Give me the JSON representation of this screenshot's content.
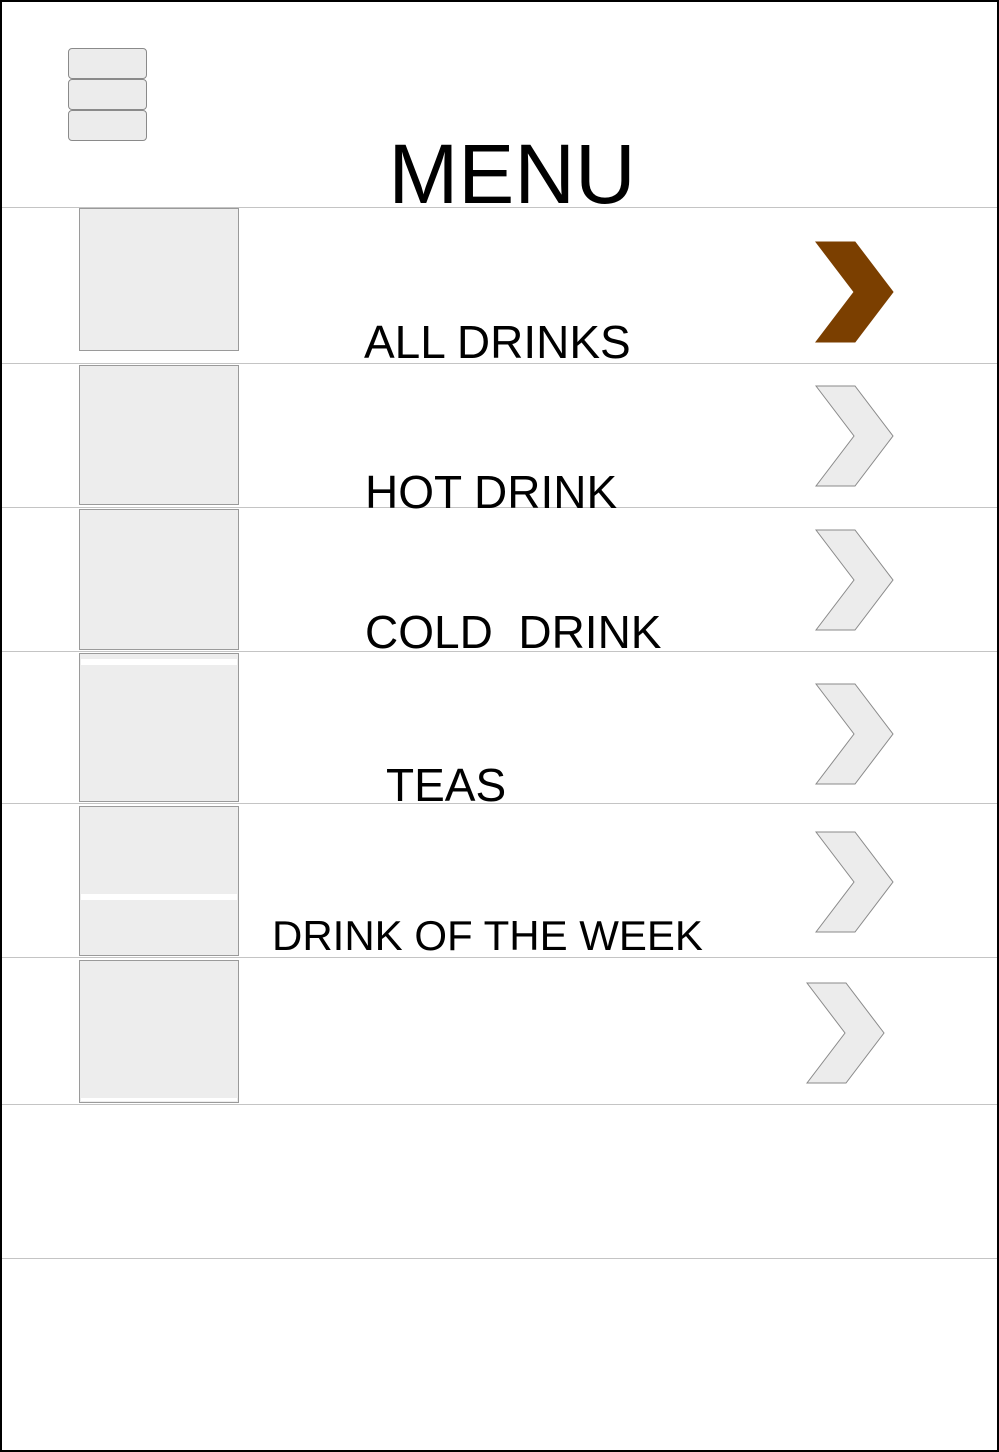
{
  "header": {
    "title": "MENU",
    "menu_icon": "hamburger-menu-icon"
  },
  "colors": {
    "accent": "#7b3f00",
    "chevron_inactive": "#ececec",
    "divider": "#c4c4c4",
    "thumb_fill": "#ededed"
  },
  "menu": {
    "items": [
      {
        "label": "ALL DRINKS",
        "icon": "chevron-right-icon",
        "selected": true
      },
      {
        "label": "HOT DRINK",
        "icon": "chevron-right-icon",
        "selected": false
      },
      {
        "label": "COLD  DRINK",
        "icon": "chevron-right-icon",
        "selected": false
      },
      {
        "label": "TEAS",
        "icon": "chevron-right-icon",
        "selected": false
      },
      {
        "label": "DRINK OF THE WEEK",
        "icon": "chevron-right-icon",
        "selected": false
      },
      {
        "label": "",
        "icon": "chevron-right-icon",
        "selected": false
      }
    ]
  }
}
